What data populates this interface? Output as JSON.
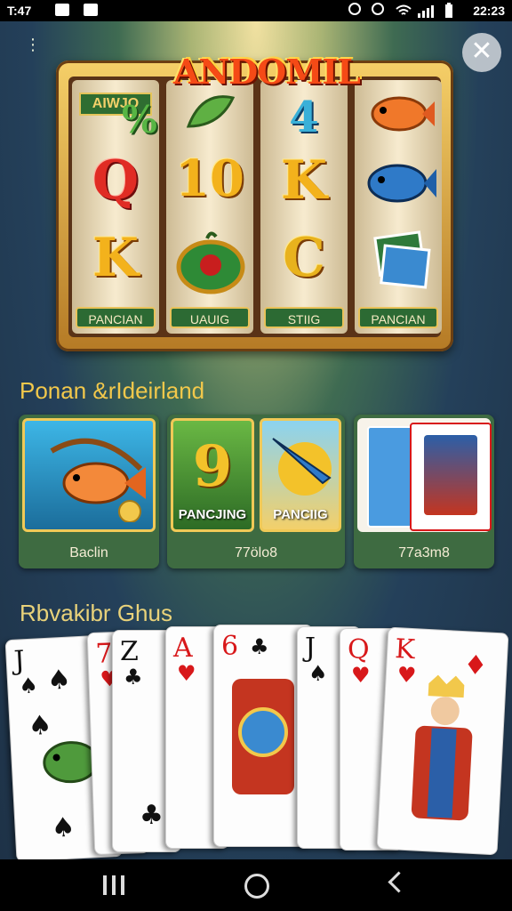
{
  "status_bar": {
    "time": "T:47",
    "right_time": "22:23"
  },
  "game": {
    "title": "ANDOMIL",
    "mini_banner": "AIWJO",
    "reels": [
      {
        "symbols": [
          "%",
          "Q",
          "K"
        ],
        "label": "PANCIAN"
      },
      {
        "symbols": [
          "",
          "10",
          ""
        ],
        "label": "UAUIG"
      },
      {
        "symbols": [
          "4",
          "K",
          "C"
        ],
        "label": "STIIG"
      },
      {
        "symbols": [
          "",
          "",
          ""
        ],
        "label": "PANCIAN"
      }
    ]
  },
  "section1": {
    "title": "Ponan &rIdeirland",
    "tiles": [
      {
        "thumb_text": "",
        "caption": "Baclin"
      },
      {
        "thumb_text": "PANCJING",
        "caption": "77ölo8"
      },
      {
        "thumb_text": "PANCIIG",
        "caption": ""
      },
      {
        "thumb_text": "",
        "caption": "77a3m8"
      }
    ]
  },
  "section2": {
    "title": "Rbvakibr Ghus",
    "cards": [
      {
        "rank": "J",
        "suit": "♠",
        "color": "black"
      },
      {
        "rank": "7",
        "suit": "♥",
        "color": "red"
      },
      {
        "rank": "Z",
        "suit": "♣",
        "color": "black"
      },
      {
        "rank": "A",
        "suit": "♥",
        "color": "red"
      },
      {
        "rank": "6",
        "suit": "♣",
        "color": "red"
      },
      {
        "rank": "J",
        "suit": "♠",
        "color": "black"
      },
      {
        "rank": "Q",
        "suit": "♥",
        "color": "red"
      },
      {
        "rank": "K",
        "suit": "♥",
        "color": "red"
      }
    ]
  },
  "controls": {
    "close_glyph": "✕",
    "menu_glyph": "⋮"
  },
  "colors": {
    "accent_gold": "#f2c84b",
    "tile_green": "#3e6b41",
    "title_red": "#f54a16"
  }
}
